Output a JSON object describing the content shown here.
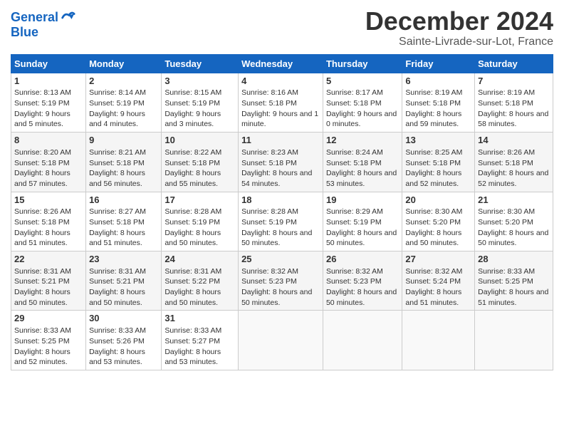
{
  "header": {
    "logo_line1": "General",
    "logo_line2": "Blue",
    "month": "December 2024",
    "location": "Sainte-Livrade-sur-Lot, France"
  },
  "weekdays": [
    "Sunday",
    "Monday",
    "Tuesday",
    "Wednesday",
    "Thursday",
    "Friday",
    "Saturday"
  ],
  "weeks": [
    [
      {
        "day": "1",
        "sunrise": "8:13 AM",
        "sunset": "5:19 PM",
        "daylight": "9 hours and 5 minutes."
      },
      {
        "day": "2",
        "sunrise": "8:14 AM",
        "sunset": "5:19 PM",
        "daylight": "9 hours and 4 minutes."
      },
      {
        "day": "3",
        "sunrise": "8:15 AM",
        "sunset": "5:19 PM",
        "daylight": "9 hours and 3 minutes."
      },
      {
        "day": "4",
        "sunrise": "8:16 AM",
        "sunset": "5:18 PM",
        "daylight": "9 hours and 1 minute."
      },
      {
        "day": "5",
        "sunrise": "8:17 AM",
        "sunset": "5:18 PM",
        "daylight": "9 hours and 0 minutes."
      },
      {
        "day": "6",
        "sunrise": "8:19 AM",
        "sunset": "5:18 PM",
        "daylight": "8 hours and 59 minutes."
      },
      {
        "day": "7",
        "sunrise": "8:19 AM",
        "sunset": "5:18 PM",
        "daylight": "8 hours and 58 minutes."
      }
    ],
    [
      {
        "day": "8",
        "sunrise": "8:20 AM",
        "sunset": "5:18 PM",
        "daylight": "8 hours and 57 minutes."
      },
      {
        "day": "9",
        "sunrise": "8:21 AM",
        "sunset": "5:18 PM",
        "daylight": "8 hours and 56 minutes."
      },
      {
        "day": "10",
        "sunrise": "8:22 AM",
        "sunset": "5:18 PM",
        "daylight": "8 hours and 55 minutes."
      },
      {
        "day": "11",
        "sunrise": "8:23 AM",
        "sunset": "5:18 PM",
        "daylight": "8 hours and 54 minutes."
      },
      {
        "day": "12",
        "sunrise": "8:24 AM",
        "sunset": "5:18 PM",
        "daylight": "8 hours and 53 minutes."
      },
      {
        "day": "13",
        "sunrise": "8:25 AM",
        "sunset": "5:18 PM",
        "daylight": "8 hours and 52 minutes."
      },
      {
        "day": "14",
        "sunrise": "8:26 AM",
        "sunset": "5:18 PM",
        "daylight": "8 hours and 52 minutes."
      }
    ],
    [
      {
        "day": "15",
        "sunrise": "8:26 AM",
        "sunset": "5:18 PM",
        "daylight": "8 hours and 51 minutes."
      },
      {
        "day": "16",
        "sunrise": "8:27 AM",
        "sunset": "5:18 PM",
        "daylight": "8 hours and 51 minutes."
      },
      {
        "day": "17",
        "sunrise": "8:28 AM",
        "sunset": "5:19 PM",
        "daylight": "8 hours and 50 minutes."
      },
      {
        "day": "18",
        "sunrise": "8:28 AM",
        "sunset": "5:19 PM",
        "daylight": "8 hours and 50 minutes."
      },
      {
        "day": "19",
        "sunrise": "8:29 AM",
        "sunset": "5:19 PM",
        "daylight": "8 hours and 50 minutes."
      },
      {
        "day": "20",
        "sunrise": "8:30 AM",
        "sunset": "5:20 PM",
        "daylight": "8 hours and 50 minutes."
      },
      {
        "day": "21",
        "sunrise": "8:30 AM",
        "sunset": "5:20 PM",
        "daylight": "8 hours and 50 minutes."
      }
    ],
    [
      {
        "day": "22",
        "sunrise": "8:31 AM",
        "sunset": "5:21 PM",
        "daylight": "8 hours and 50 minutes."
      },
      {
        "day": "23",
        "sunrise": "8:31 AM",
        "sunset": "5:21 PM",
        "daylight": "8 hours and 50 minutes."
      },
      {
        "day": "24",
        "sunrise": "8:31 AM",
        "sunset": "5:22 PM",
        "daylight": "8 hours and 50 minutes."
      },
      {
        "day": "25",
        "sunrise": "8:32 AM",
        "sunset": "5:23 PM",
        "daylight": "8 hours and 50 minutes."
      },
      {
        "day": "26",
        "sunrise": "8:32 AM",
        "sunset": "5:23 PM",
        "daylight": "8 hours and 50 minutes."
      },
      {
        "day": "27",
        "sunrise": "8:32 AM",
        "sunset": "5:24 PM",
        "daylight": "8 hours and 51 minutes."
      },
      {
        "day": "28",
        "sunrise": "8:33 AM",
        "sunset": "5:25 PM",
        "daylight": "8 hours and 51 minutes."
      }
    ],
    [
      {
        "day": "29",
        "sunrise": "8:33 AM",
        "sunset": "5:25 PM",
        "daylight": "8 hours and 52 minutes."
      },
      {
        "day": "30",
        "sunrise": "8:33 AM",
        "sunset": "5:26 PM",
        "daylight": "8 hours and 53 minutes."
      },
      {
        "day": "31",
        "sunrise": "8:33 AM",
        "sunset": "5:27 PM",
        "daylight": "8 hours and 53 minutes."
      },
      null,
      null,
      null,
      null
    ]
  ]
}
